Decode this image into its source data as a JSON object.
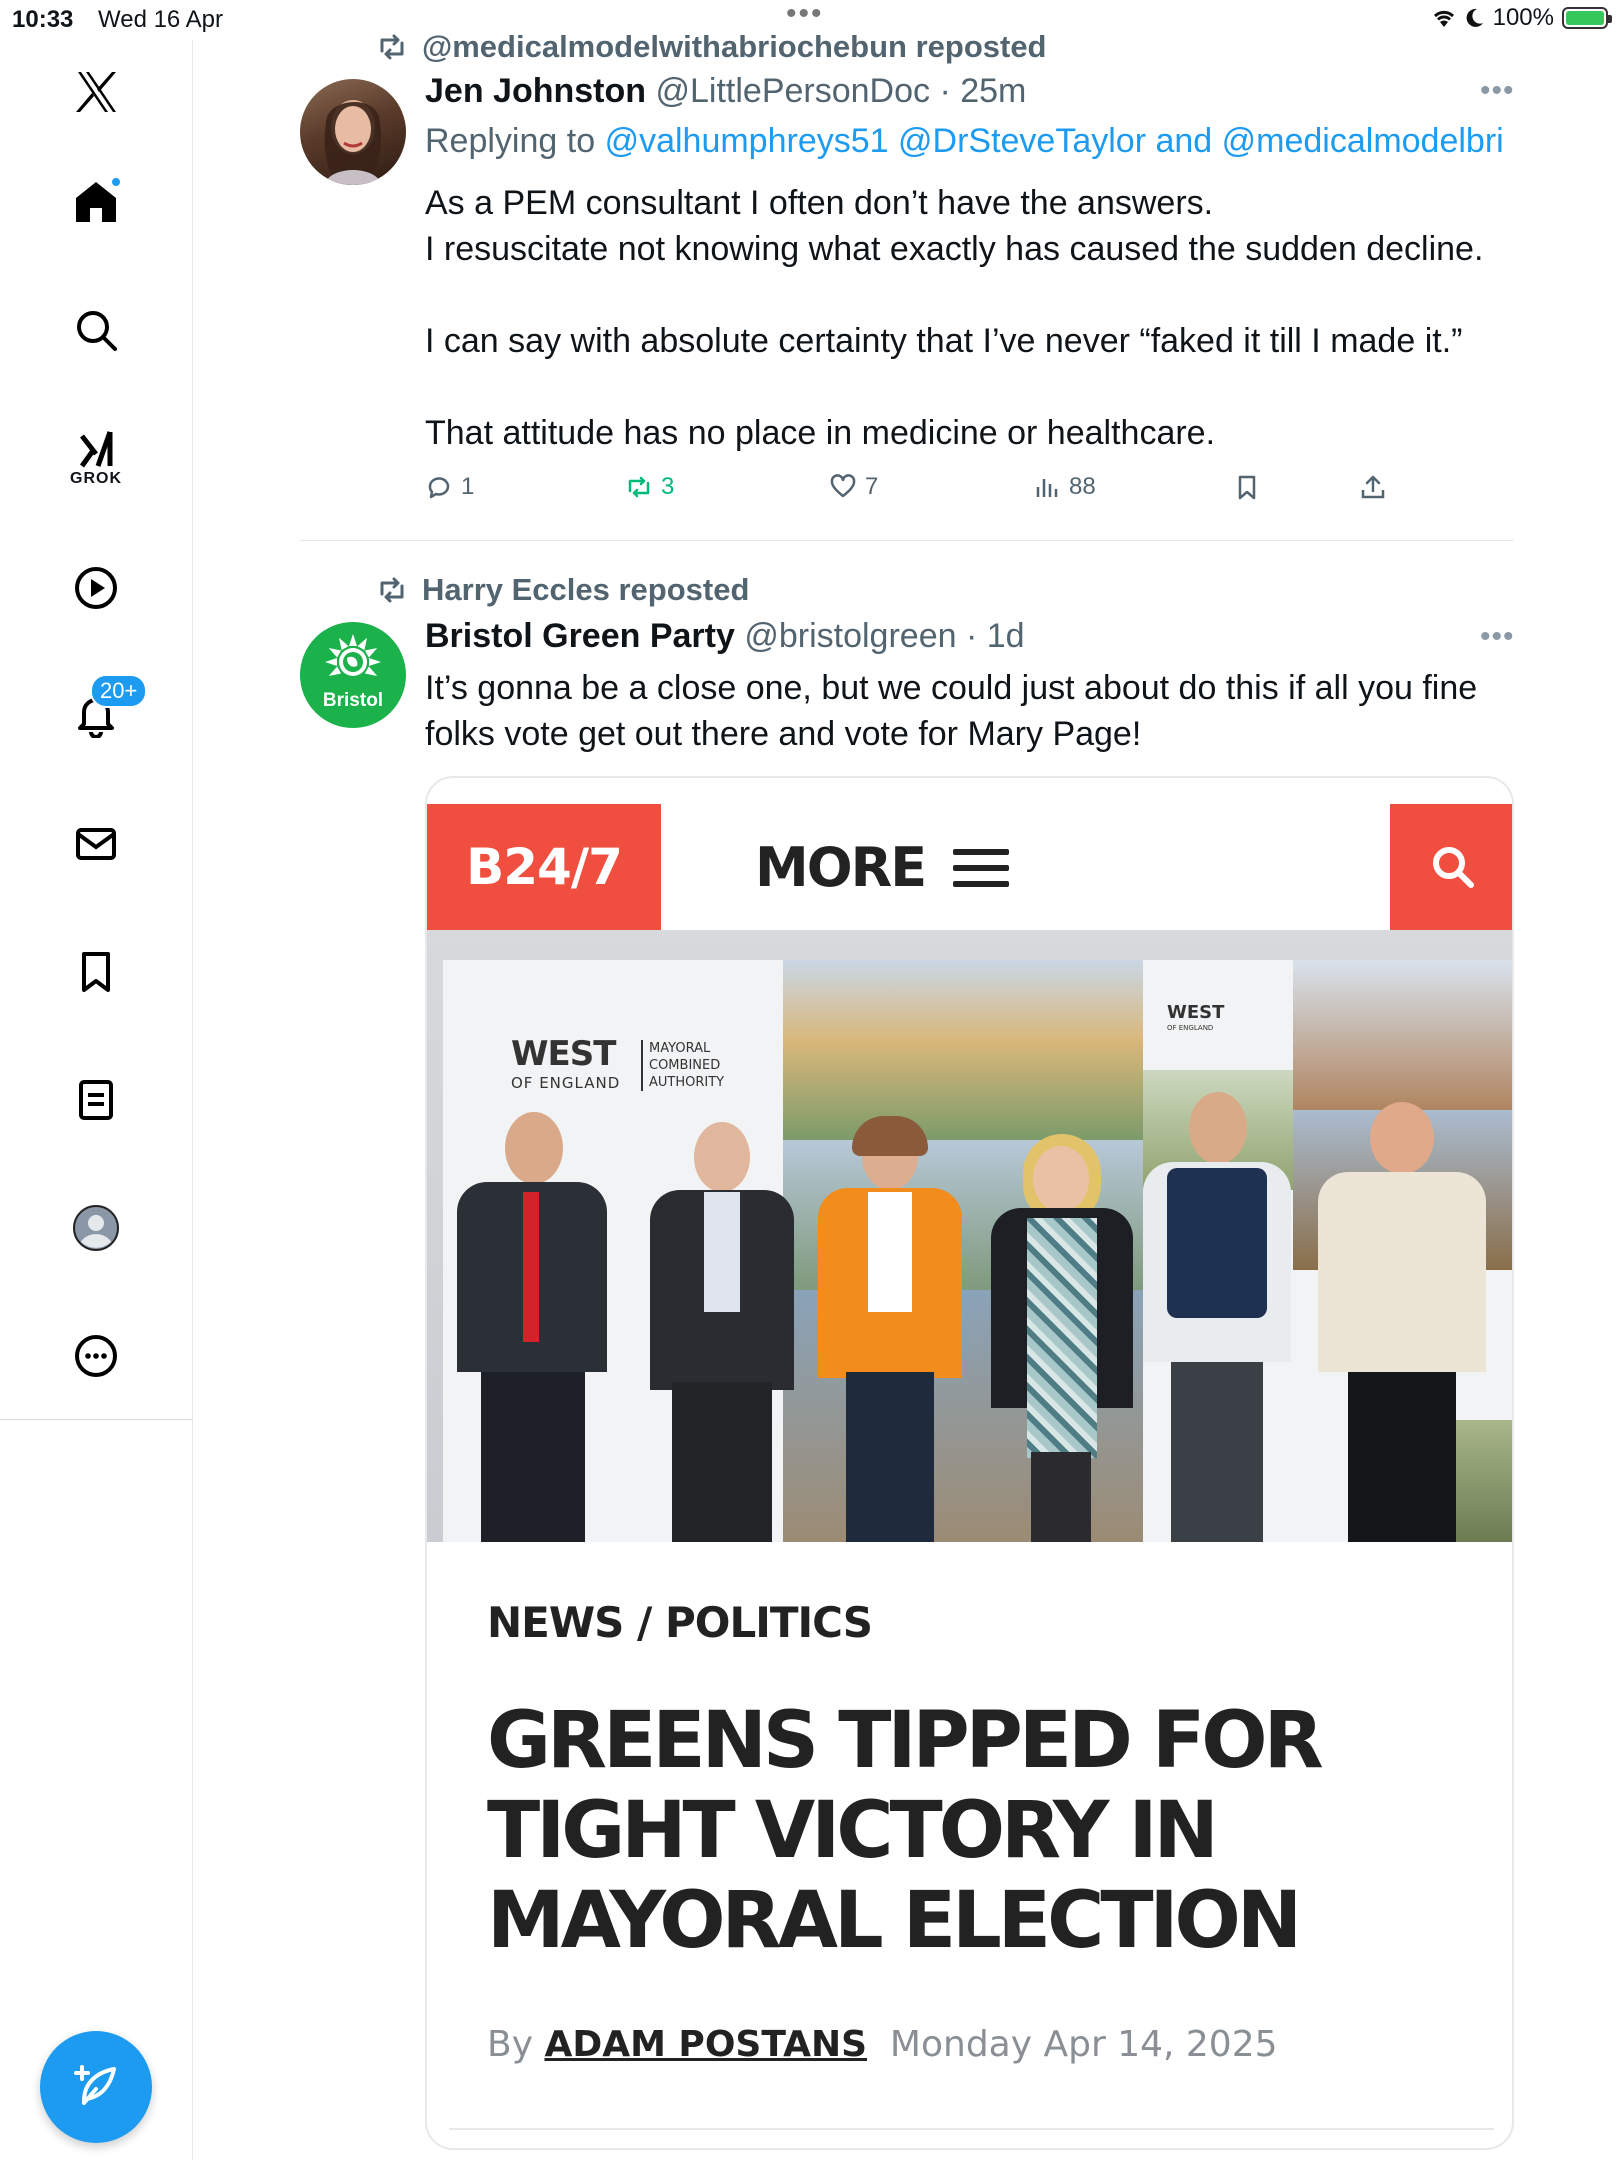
{
  "status_bar": {
    "time": "10:33",
    "date": "Wed 16 Apr",
    "battery": "100%"
  },
  "sidebar": {
    "grok_label": "GROK",
    "notifications_badge": "20+",
    "icons": [
      "x-logo-icon",
      "home-icon",
      "search-icon",
      "grok-icon",
      "video-icon",
      "notifications-icon",
      "messages-icon",
      "bookmarks-icon",
      "lists-icon",
      "profile-icon",
      "more-icon",
      "compose-icon"
    ]
  },
  "post1": {
    "repost_label": "@medicalmodelwithabriochebun reposted",
    "name": "Jen Johnston",
    "handle": "@LittlePersonDoc",
    "time": "· 25m",
    "replying_prefix": "Replying to",
    "replying_links": "@valhumphreys51 @DrSteveTaylor and @medicalmodelbri",
    "body": [
      "As a PEM consultant I often don’t have the answers.",
      "I resuscitate not knowing what exactly has caused the sudden decline.",
      "",
      "I can say with absolute certainty that I’ve never “faked it till I made it.”",
      "",
      "That attitude has no place in medicine or healthcare."
    ],
    "actions": {
      "replies": "1",
      "reposts": "3",
      "likes": "7",
      "views": "88"
    }
  },
  "post2": {
    "repost_label": "Harry Eccles reposted",
    "name": "Bristol Green Party",
    "handle": "@bristolgreen",
    "time": "· 1d",
    "avatar_label": "Bristol",
    "body": [
      "It’s gonna be a close one, but we could just about do this if all you fine",
      "folks vote get out there and vote for Mary Page!"
    ],
    "card": {
      "site_logo": "B24/7",
      "site_more": "MORE",
      "photo_text": {
        "brand_main": "WEST",
        "brand_sub": "OF ENGLAND",
        "brand_side_1": "MAYORAL",
        "brand_side_2": "COMBINED",
        "brand_side_3": "AUTHORITY"
      },
      "category": "NEWS / POLITICS",
      "title": "GREENS TIPPED FOR TIGHT VICTORY IN MAYORAL ELECTION",
      "byline_prefix": "By",
      "author": "ADAM POSTANS",
      "date": "Monday Apr 14, 2025"
    }
  },
  "colors": {
    "accent": "#1d9bf0",
    "repost_green": "#00ba7c",
    "site_red": "#f04e3e",
    "green_party": "#1bb14b"
  }
}
